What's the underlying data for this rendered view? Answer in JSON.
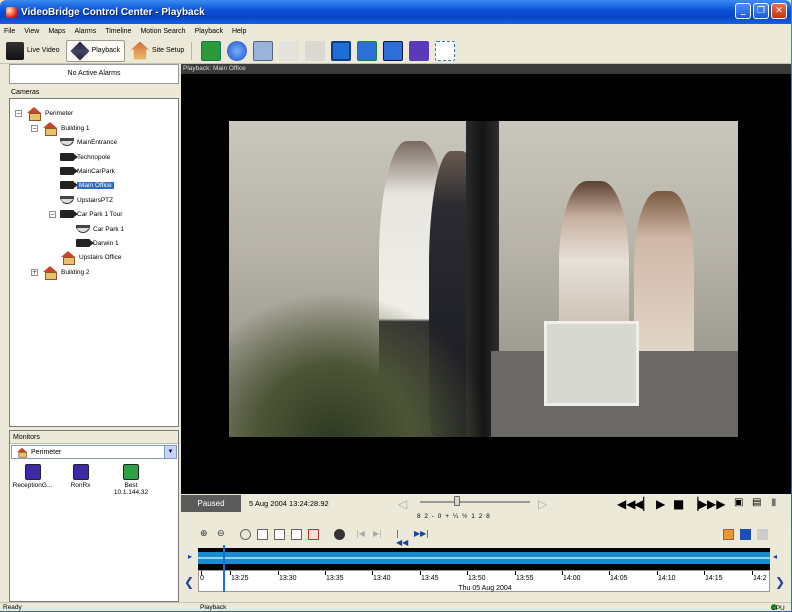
{
  "window": {
    "title": "VideoBridge Control Center - Playback"
  },
  "menu": [
    "File",
    "View",
    "Maps",
    "Alarms",
    "Timeline",
    "Motion Search",
    "Playback",
    "Help"
  ],
  "toolbar": {
    "live_video": "Live Video",
    "playback": "Playback",
    "site_setup": "Site Setup"
  },
  "alarms": {
    "text": "No Active Alarms"
  },
  "cameras": {
    "header": "Cameras",
    "nodes": [
      "Perimeter",
      "Building 1",
      "MainEntrance",
      "Technopole",
      "MainCarPark",
      "Main Office",
      "UpstairsPTZ",
      "Car Park 1 Tour",
      "Car Park 1",
      "Darwin 1",
      "Upstairs Office",
      "Building 2"
    ],
    "selected": "Main Office"
  },
  "monitors": {
    "header": "Monitors",
    "group": "Perimeter",
    "items": [
      {
        "name": "ReceptionG...",
        "sub": "",
        "color": "#3b2aa8"
      },
      {
        "name": "RonRx",
        "sub": "",
        "color": "#3b2aa8"
      },
      {
        "name": "Best",
        "sub": "10.1.144.32",
        "color": "#2da048"
      }
    ]
  },
  "playback": {
    "view_title": "Playback: Main Office",
    "state": "Paused",
    "timestamp": "5 Aug 2004 13:24:28.92",
    "speed_scale": "8  2  -  0  +  ¼  ½  1  2  8"
  },
  "timeline": {
    "ticks": [
      "0",
      "13:25",
      "13:30",
      "13:35",
      "13:40",
      "13:45",
      "13:50",
      "13:55",
      "14:00",
      "14:05",
      "14:10",
      "14:15",
      "14:2"
    ],
    "date": "Thu 05 Aug 2004"
  },
  "status": {
    "left": "Ready",
    "center": "Playback",
    "cpu": "CPU"
  },
  "colors": {
    "title_bar": "#0a4fd6",
    "timeline_blue": "#1b8ad0",
    "selection": "#316ac5"
  }
}
